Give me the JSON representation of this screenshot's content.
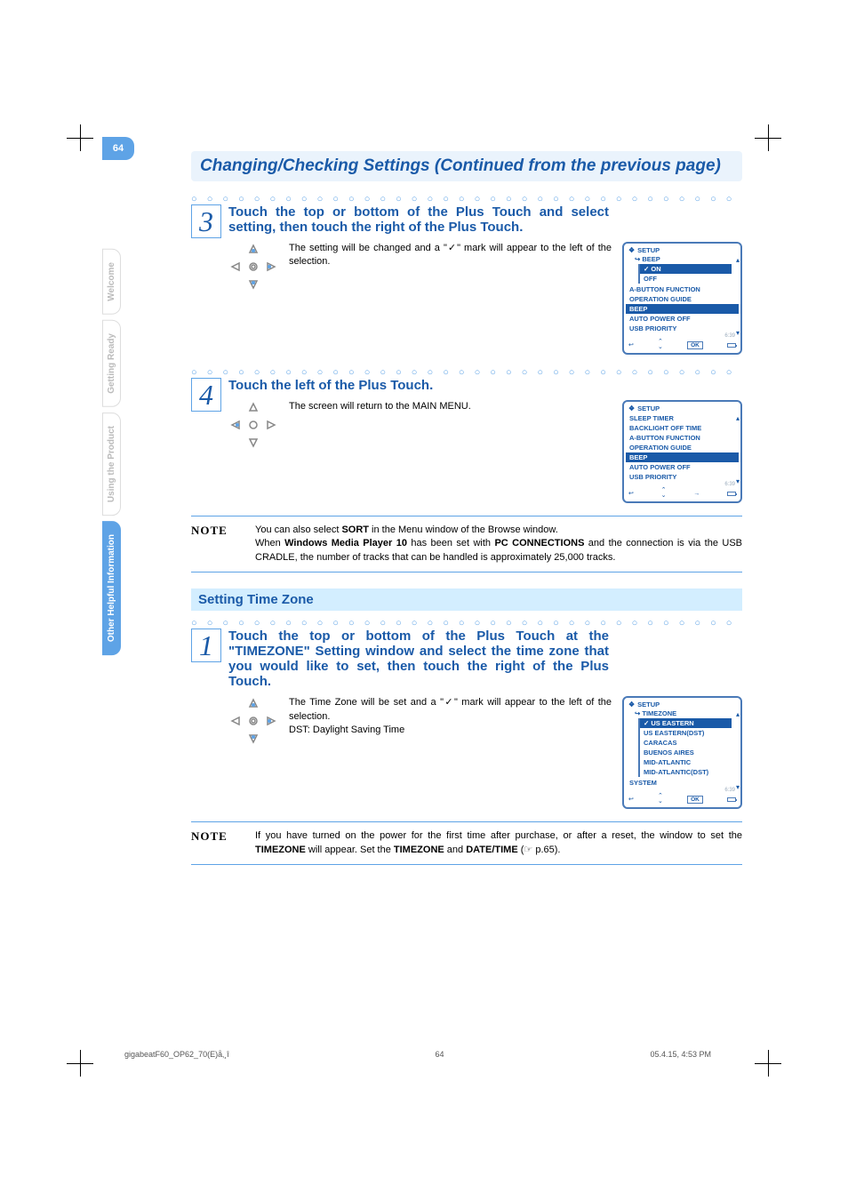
{
  "header": {
    "title": "Changing/Checking Settings (Continued from the previous page)"
  },
  "sideTabs": [
    {
      "label": "Welcome",
      "active": false
    },
    {
      "label": "Getting Ready",
      "active": false
    },
    {
      "label": "Using the Product",
      "active": false
    },
    {
      "label": "Other Helpful Information",
      "active": true
    }
  ],
  "pageNumber": "64",
  "step3": {
    "num": "3",
    "title": "Touch the top or bottom of the Plus Touch and select setting, then touch the right of the Plus Touch.",
    "body": "The setting will be changed and a \"✓\" mark will appear to the left of the selection."
  },
  "screenA": {
    "header": "SETUP",
    "sub": "BEEP",
    "options": [
      "ON",
      "OFF"
    ],
    "selected": "ON",
    "items": [
      "A-BUTTON FUNCTION",
      "OPERATION GUIDE",
      "BEEP",
      "AUTO POWER OFF",
      "USB PRIORITY"
    ],
    "highlight": "BEEP",
    "time": "6:39",
    "okLabel": "OK"
  },
  "step4": {
    "num": "4",
    "title": "Touch the left of the Plus Touch.",
    "body": "The screen will return to the MAIN MENU."
  },
  "screenB": {
    "header": "SETUP",
    "items": [
      "SLEEP TIMER",
      "BACKLIGHT OFF  TIME",
      "A-BUTTON FUNCTION",
      "OPERATION GUIDE",
      "BEEP",
      "AUTO POWER OFF",
      "USB PRIORITY"
    ],
    "highlight": "BEEP",
    "time": "6:39"
  },
  "note1": {
    "label": "NOTE",
    "line1_a": "You can also select ",
    "line1_b": "SORT",
    "line1_c": " in the Menu window of the Browse window.",
    "line2_a": "When ",
    "line2_b": "Windows Media Player 10",
    "line2_c": " has been set with ",
    "line2_d": "PC CONNECTIONS",
    "line2_e": " and the connection is via the USB CRADLE, the number of tracks that can be handled is approximately 25,000 tracks."
  },
  "section2": {
    "title": "Setting Time Zone"
  },
  "step1b": {
    "num": "1",
    "title": "Touch the top or bottom of the Plus Touch at the \"TIMEZONE\" Setting window and select the time zone that you would like to set, then touch the right of the Plus Touch.",
    "body1": "The Time Zone will be set and a \"✓\" mark will appear to the left of the selection.",
    "body2": "DST: Daylight Saving Time"
  },
  "screenC": {
    "header": "SETUP",
    "sub": "TIMEZONE",
    "options": [
      "US EASTERN",
      "US EASTERN(DST)",
      "CARACAS",
      "BUENOS AIRES",
      "MID-ATLANTIC",
      "MID-ATLANTIC(DST)"
    ],
    "selected": "US EASTERN",
    "belowItem": "SYSTEM",
    "time": "6:39",
    "okLabel": "OK"
  },
  "note2": {
    "label": "NOTE",
    "a": "If you have turned on the power for the first time after purchase, or after a reset, the window to set the ",
    "b": "TIMEZONE",
    "c": " will appear. Set the ",
    "d": "TIMEZONE",
    "e": " and ",
    "f": "DATE/TIME",
    "g": " (",
    "h": "p.65",
    "i": ")."
  },
  "footer": {
    "file": "gigabeatF60_OP62_70(E)å‚¸î",
    "page": "64",
    "timestamp": "05.4.15, 4:53 PM"
  }
}
